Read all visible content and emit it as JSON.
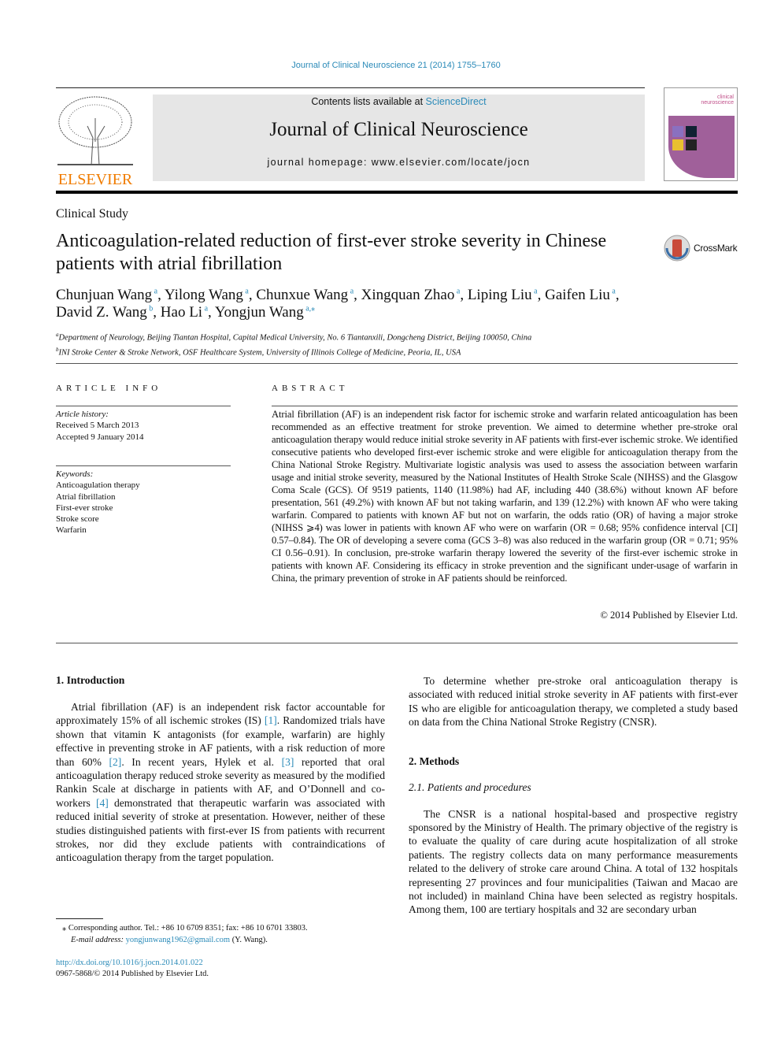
{
  "header": {
    "citation": "Journal of Clinical Neuroscience 21 (2014) 1755–1760",
    "contents_prefix": "Contents lists available at ",
    "sciencedirect": "ScienceDirect",
    "journal_title": "Journal of Clinical Neuroscience",
    "homepage": "journal homepage: www.elsevier.com/locate/jocn",
    "publisher_logo": "ELSEVIER",
    "cover_text": "clinical neuroscience"
  },
  "article": {
    "type": "Clinical Study",
    "title": "Anticoagulation-related reduction of first-ever stroke severity in Chinese patients with atrial fibrillation",
    "crossmark": "CrossMark",
    "authors": [
      {
        "name": "Chunjuan Wang",
        "aff": "a"
      },
      {
        "name": "Yilong Wang",
        "aff": "a"
      },
      {
        "name": "Chunxue Wang",
        "aff": "a"
      },
      {
        "name": "Xingquan Zhao",
        "aff": "a"
      },
      {
        "name": "Liping Liu",
        "aff": "a"
      },
      {
        "name": "Gaifen Liu",
        "aff": "a"
      },
      {
        "name": "David Z. Wang",
        "aff": "b"
      },
      {
        "name": "Hao Li",
        "aff": "a"
      },
      {
        "name": "Yongjun Wang",
        "aff": "a,⁎"
      }
    ],
    "affiliations": [
      {
        "mark": "a",
        "text": "Department of Neurology, Beijing Tiantan Hospital, Capital Medical University, No. 6 Tiantanxili, Dongcheng District, Beijing 100050, China"
      },
      {
        "mark": "b",
        "text": "INI Stroke Center & Stroke Network, OSF Healthcare System, University of Illinois College of Medicine, Peoria, IL, USA"
      }
    ]
  },
  "info": {
    "heading": "ARTICLE INFO",
    "history_label": "Article history:",
    "received": "Received 5 March 2013",
    "accepted": "Accepted 9 January 2014",
    "keywords_label": "Keywords:",
    "keywords": [
      "Anticoagulation therapy",
      "Atrial fibrillation",
      "First-ever stroke",
      "Stroke score",
      "Warfarin"
    ]
  },
  "abstract": {
    "heading": "ABSTRACT",
    "text": "Atrial fibrillation (AF) is an independent risk factor for ischemic stroke and warfarin related anticoagulation has been recommended as an effective treatment for stroke prevention. We aimed to determine whether pre-stroke oral anticoagulation therapy would reduce initial stroke severity in AF patients with first-ever ischemic stroke. We identified consecutive patients who developed first-ever ischemic stroke and were eligible for anticoagulation therapy from the China National Stroke Registry. Multivariate logistic analysis was used to assess the association between warfarin usage and initial stroke severity, measured by the National Institutes of Health Stroke Scale (NIHSS) and the Glasgow Coma Scale (GCS). Of 9519 patients, 1140 (11.98%) had AF, including 440 (38.6%) without known AF before presentation, 561 (49.2%) with known AF but not taking warfarin, and 139 (12.2%) with known AF who were taking warfarin. Compared to patients with known AF but not on warfarin, the odds ratio (OR) of having a major stroke (NIHSS ⩾4) was lower in patients with known AF who were on warfarin (OR = 0.68; 95% confidence interval [CI] 0.57–0.84). The OR of developing a severe coma (GCS 3–8) was also reduced in the warfarin group (OR = 0.71; 95% CI 0.56–0.91). In conclusion, pre-stroke warfarin therapy lowered the severity of the first-ever ischemic stroke in patients with known AF. Considering its efficacy in stroke prevention and the significant under-usage of warfarin in China, the primary prevention of stroke in AF patients should be reinforced.",
    "copyright": "© 2014 Published by Elsevier Ltd."
  },
  "body": {
    "intro_heading": "1. Introduction",
    "intro": [
      {
        "t": "Atrial fibrillation (AF) is an independent risk factor accountable for approximately 15% of all ischemic strokes (IS) "
      },
      {
        "r": "[1]"
      },
      {
        "t": ". Randomized trials have shown that vitamin K antagonists (for example, warfarin) are highly effective in preventing stroke in AF patients, with a risk reduction of more than 60% "
      },
      {
        "r": "[2]"
      },
      {
        "t": ". In recent years, Hylek et al. "
      },
      {
        "r": "[3]"
      },
      {
        "t": " reported that oral anticoagulation therapy reduced stroke severity as measured by the modified Rankin Scale at discharge in patients with AF, and O’Donnell and co-workers "
      },
      {
        "r": "[4]"
      },
      {
        "t": " demonstrated that therapeutic warfarin was associated with reduced initial severity of stroke at presentation. However, neither of these studies distinguished patients with first-ever IS from patients with recurrent strokes, nor did they exclude patients with contraindications of anticoagulation therapy from the target population."
      }
    ],
    "intro2": "To determine whether pre-stroke oral anticoagulation therapy is associated with reduced initial stroke severity in AF patients with first-ever IS who are eligible for anticoagulation therapy, we completed a study based on data from the China National Stroke Registry (CNSR).",
    "methods_heading": "2. Methods",
    "sub_heading": "2.1. Patients and procedures",
    "methods": "The CNSR is a national hospital-based and prospective registry sponsored by the Ministry of Health. The primary objective of the registry is to evaluate the quality of care during acute hospitalization of all stroke patients. The registry collects data on many performance measurements related to the delivery of stroke care around China. A total of 132 hospitals representing 27 provinces and four municipalities (Taiwan and Macao are not included) in mainland China have been selected as registry hospitals. Among them, 100 are tertiary hospitals and 32 are secondary urban"
  },
  "footnote": {
    "mark": "⁎",
    "text": "Corresponding author. Tel.: +86 10 6709 8351; fax: +86 10 6701 33803.",
    "email_label": "E-mail address: ",
    "email": "yongjunwang1962@gmail.com",
    "email_suffix": " (Y. Wang)."
  },
  "footer": {
    "doi": "http://dx.doi.org/10.1016/j.jocn.2014.01.022",
    "issn": "0967-5868/© 2014 Published by Elsevier Ltd."
  },
  "colors": {
    "link": "#2a8ab8",
    "elsevier_orange": "#f07c00",
    "cover_purple": "#a0609a",
    "header_gray": "#e6e6e6"
  }
}
